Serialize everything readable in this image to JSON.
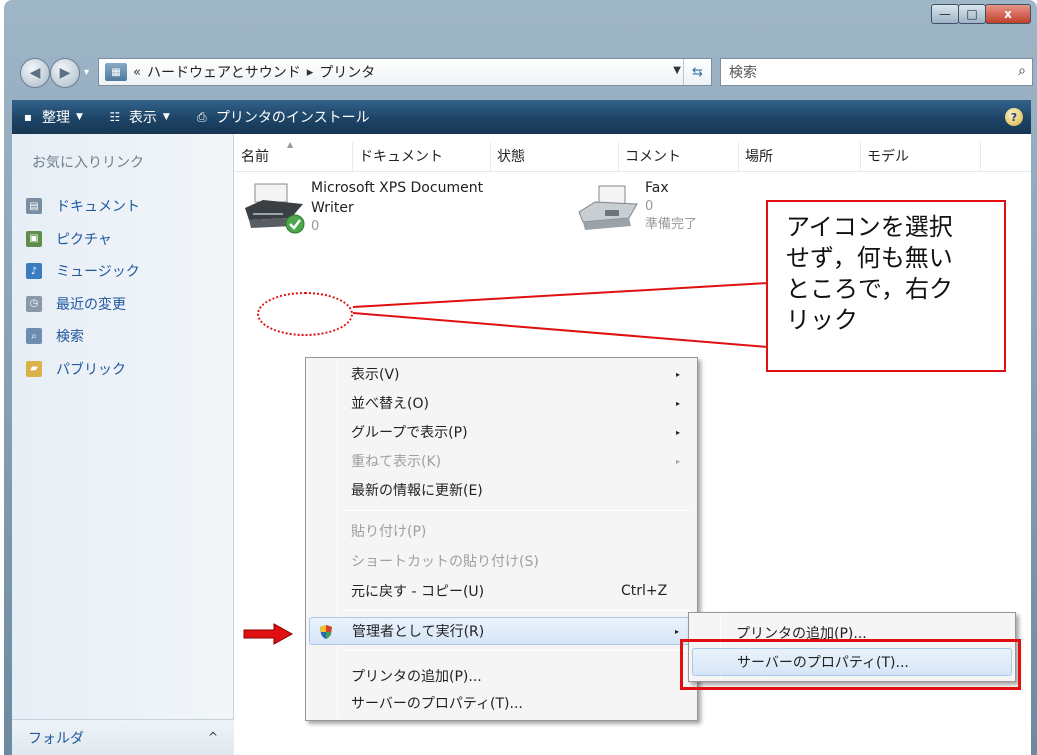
{
  "window": {
    "buttons": {
      "minimize": "—",
      "maximize": "□",
      "close": "x"
    }
  },
  "nav": {
    "back_icon": "arrow-left",
    "forward_icon": "arrow-right",
    "address": {
      "overflow": "«",
      "crumbs": [
        "ハードウェアとサウンド",
        "プリンタ"
      ],
      "separator": "▸"
    },
    "search_placeholder": "検索"
  },
  "command_bar": {
    "items": [
      {
        "label": "整理",
        "has_dropdown": true
      },
      {
        "label": "表示",
        "has_dropdown": true
      },
      {
        "label": "プリンタのインストール",
        "has_dropdown": false
      }
    ],
    "help": "?"
  },
  "sidebar": {
    "title": "お気に入りリンク",
    "items": [
      {
        "label": "ドキュメント",
        "color": "#7a8ea3"
      },
      {
        "label": "ピクチャ",
        "color": "#5e8e4c"
      },
      {
        "label": "ミュージック",
        "color": "#3b7bbf"
      },
      {
        "label": "最近の変更",
        "color": "#8a98a8"
      },
      {
        "label": "検索",
        "color": "#6d8db0"
      },
      {
        "label": "パブリック",
        "color": "#d9b24a"
      }
    ],
    "folder_label": "フォルダ",
    "folder_caret": "^"
  },
  "columns": [
    "名前",
    "ドキュメント",
    "状態",
    "コメント",
    "場所",
    "モデル"
  ],
  "printers": [
    {
      "name_line1": "Microsoft XPS Document",
      "name_line2": "Writer",
      "count": "0",
      "status": ""
    },
    {
      "name_line1": "Fax",
      "name_line2": "",
      "count": "0",
      "status": "準備完了"
    }
  ],
  "callout": {
    "text_lines": [
      "アイコンを選択",
      "せず，何も無い",
      "ところで，右ク",
      "リック"
    ],
    "color": "#e01010"
  },
  "context_menu": {
    "items": [
      {
        "label": "表示(V)",
        "arrow": "▸",
        "disabled": false
      },
      {
        "label": "並べ替え(O)",
        "arrow": "▸",
        "disabled": false
      },
      {
        "label": "グループで表示(P)",
        "arrow": "▸",
        "disabled": false
      },
      {
        "label": "重ねて表示(K)",
        "arrow": "▸",
        "disabled": true
      },
      {
        "label": "最新の情報に更新(E)",
        "arrow": "",
        "disabled": false
      },
      {
        "label": "貼り付け(P)",
        "arrow": "",
        "disabled": true
      },
      {
        "label": "ショートカットの貼り付け(S)",
        "arrow": "",
        "disabled": true
      },
      {
        "label": "元に戻す - コピー(U)",
        "shortcut": "Ctrl+Z",
        "disabled": false
      },
      {
        "label": "管理者として実行(R)",
        "arrow": "▸",
        "disabled": false
      },
      {
        "label": "プリンタの追加(P)...",
        "arrow": "",
        "disabled": false
      },
      {
        "label": "サーバーのプロパティ(T)...",
        "arrow": "",
        "disabled": false
      }
    ]
  },
  "submenu": {
    "items": [
      {
        "label": "プリンタの追加(P)..."
      },
      {
        "label": "サーバーのプロパティ(T)..."
      }
    ]
  }
}
